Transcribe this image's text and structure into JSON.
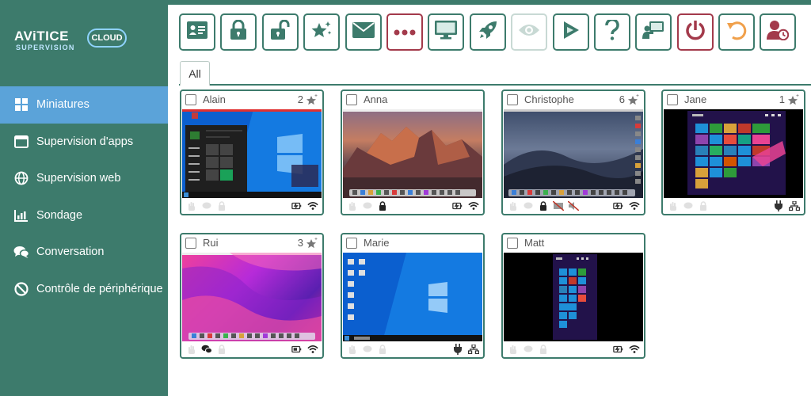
{
  "app": {
    "logo_brand": "AViTICE",
    "logo_sub": "SUPERVISION",
    "logo_cloud": "CLOUD"
  },
  "colors": {
    "primary": "#3d7b6c",
    "active_nav": "#5ba3d9",
    "danger": "#a33a4b",
    "warning": "#f0a04b",
    "disabled": "#c8d9d4"
  },
  "sidebar": {
    "items": [
      {
        "label": "Miniatures",
        "icon": "grid-icon",
        "active": true
      },
      {
        "label": "Supervision d'apps",
        "icon": "window-icon",
        "active": false
      },
      {
        "label": "Supervision web",
        "icon": "globe-icon",
        "active": false
      },
      {
        "label": "Sondage",
        "icon": "bar-chart-icon",
        "active": false
      },
      {
        "label": "Conversation",
        "icon": "chat-icon",
        "active": false
      },
      {
        "label": "Contrôle de périphérique",
        "icon": "forbidden-icon",
        "active": false
      }
    ]
  },
  "toolbar": {
    "buttons": [
      {
        "icon": "id-card-icon"
      },
      {
        "icon": "lock-icon"
      },
      {
        "icon": "unlock-icon"
      },
      {
        "icon": "star-sparkle-icon"
      },
      {
        "icon": "envelope-icon"
      },
      {
        "icon": "more-dots-icon"
      },
      {
        "icon": "monitor-icon"
      },
      {
        "icon": "rocket-icon"
      },
      {
        "icon": "eye-icon"
      },
      {
        "icon": "play-icon"
      },
      {
        "icon": "question-icon"
      },
      {
        "icon": "presenter-icon"
      },
      {
        "icon": "power-icon"
      },
      {
        "icon": "undo-icon"
      },
      {
        "icon": "user-clock-icon"
      }
    ]
  },
  "tabs": [
    {
      "label": "All"
    }
  ],
  "students": [
    {
      "name": "Alain",
      "count": "2"
    },
    {
      "name": "Anna",
      "count": ""
    },
    {
      "name": "Christophe",
      "count": "6"
    },
    {
      "name": "Jane",
      "count": "1"
    },
    {
      "name": "Rui",
      "count": "3"
    },
    {
      "name": "Marie",
      "count": ""
    },
    {
      "name": "Matt",
      "count": ""
    }
  ]
}
